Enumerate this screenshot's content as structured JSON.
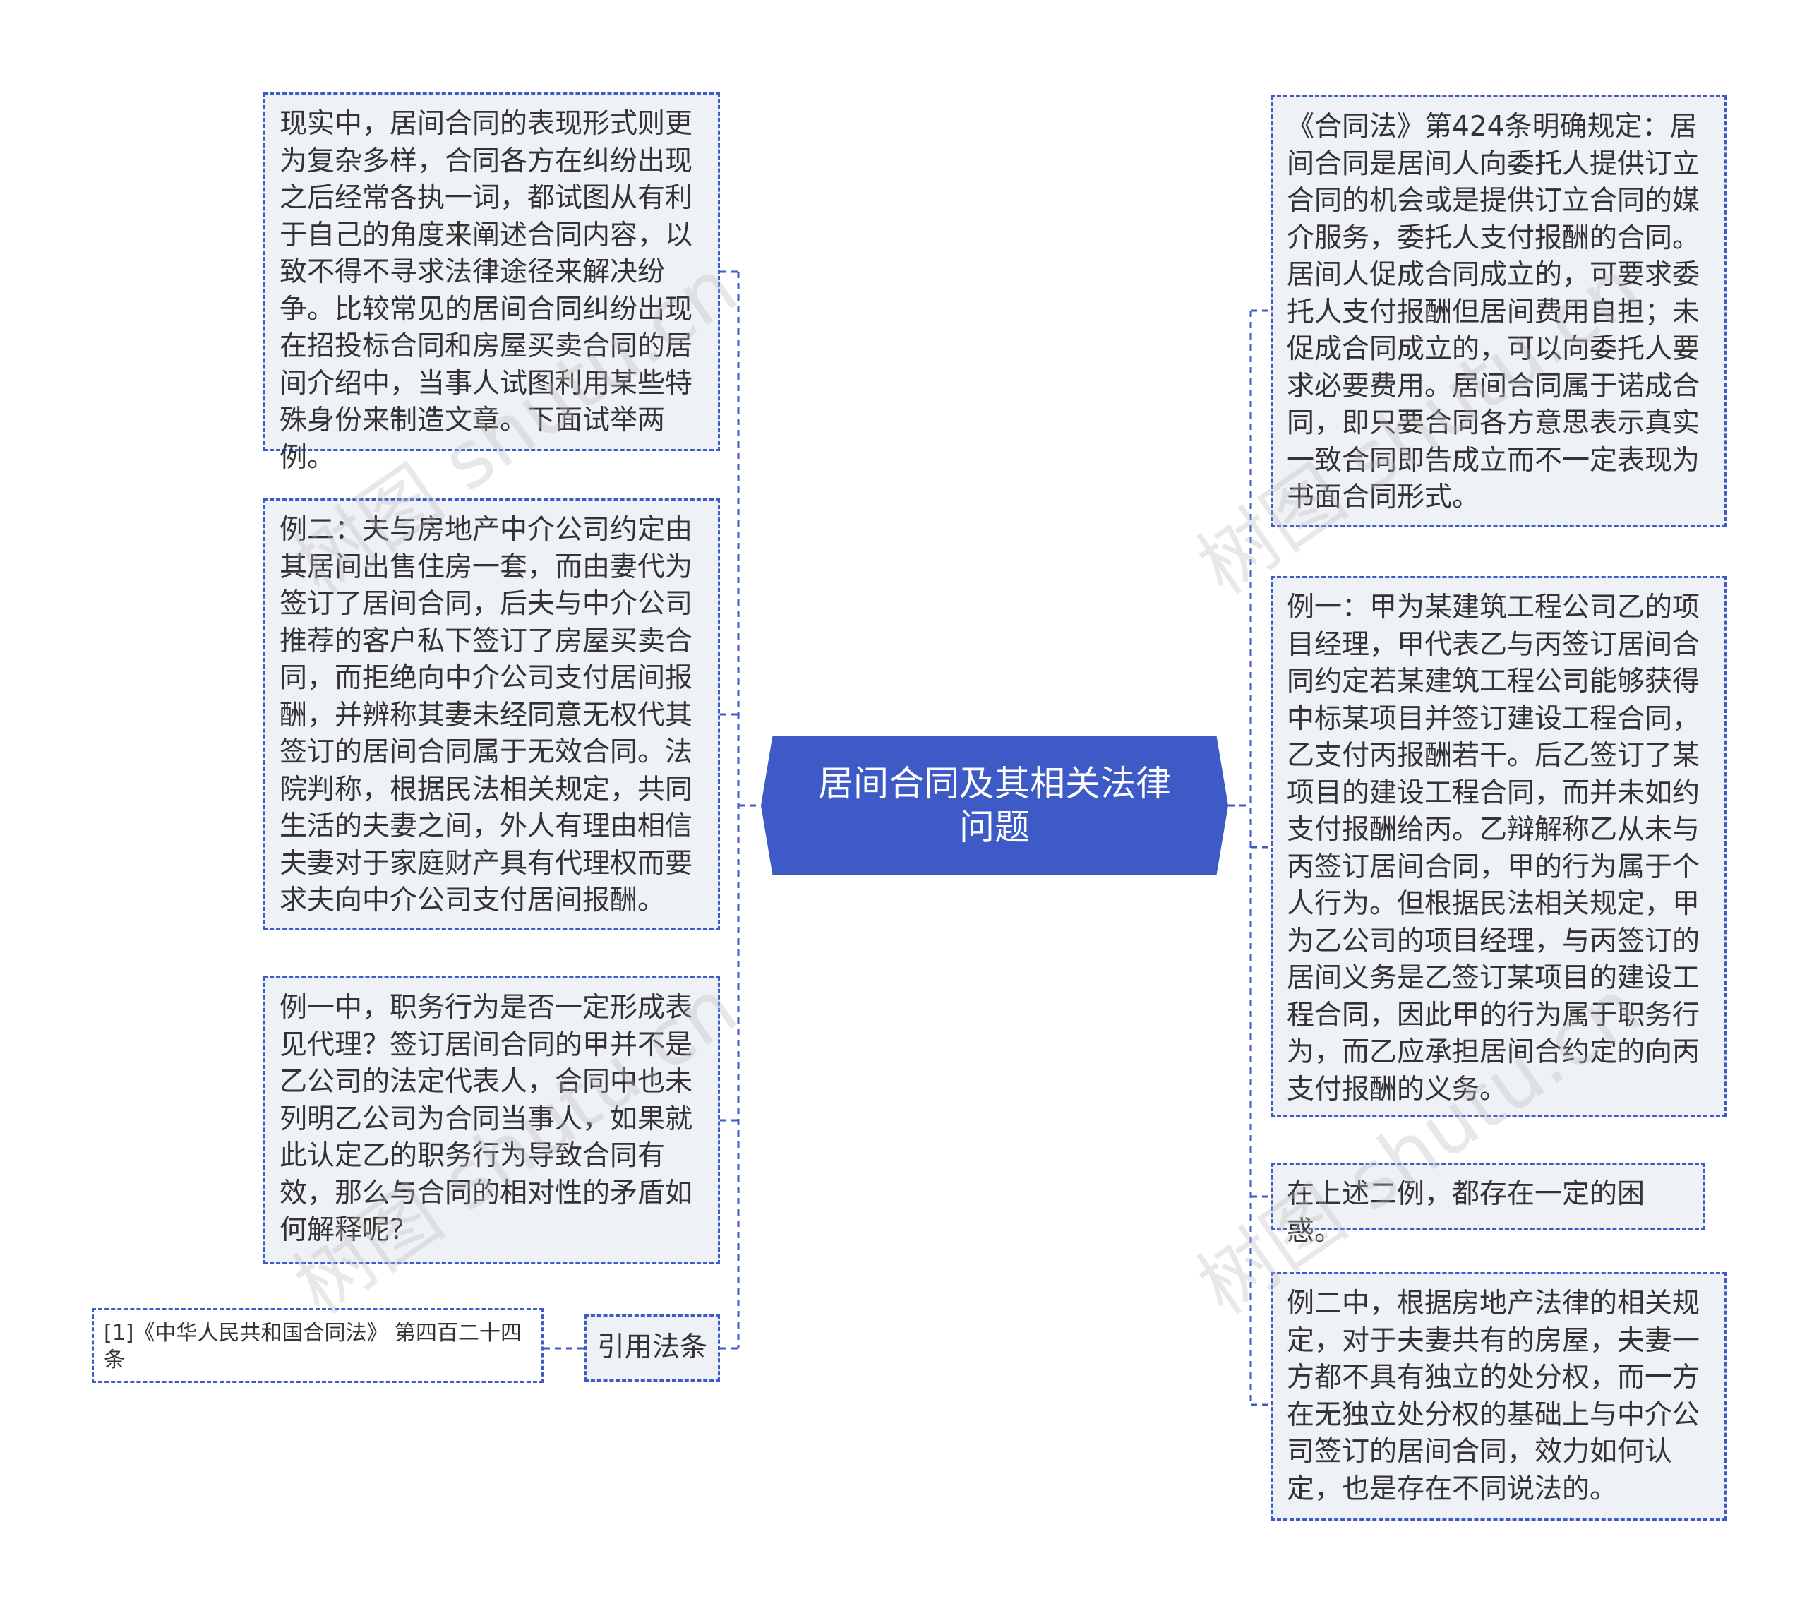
{
  "center": {
    "title": "居间合同及其相关法律问题"
  },
  "left_nodes": [
    {
      "text": "现实中，居间合同的表现形式则更为复杂多样，合同各方在纠纷出现之后经常各执一词，都试图从有利于自己的角度来阐述合同内容，以致不得不寻求法律途径来解决纷争。比较常见的居间合同纠纷出现在招投标合同和房屋买卖合同的居间介绍中，当事人试图利用某些特殊身份来制造文章。下面试举两例。"
    },
    {
      "text": "例二：夫与房地产中介公司约定由其居间出售住房一套，而由妻代为签订了居间合同，后夫与中介公司推荐的客户私下签订了房屋买卖合同，而拒绝向中介公司支付居间报酬，并辨称其妻未经同意无权代其签订的居间合同属于无效合同。法院判称，根据民法相关规定，共同生活的夫妻之间，外人有理由相信夫妻对于家庭财产具有代理权而要求夫向中介公司支付居间报酬。"
    },
    {
      "text": "例一中，职务行为是否一定形成表见代理？签订居间合同的甲并不是乙公司的法定代表人，合同中也未列明乙公司为合同当事人，如果就此认定乙的职务行为导致合同有效，那么与合同的相对性的矛盾如何解释呢？"
    }
  ],
  "citation": {
    "label": "引用法条",
    "reference": "[1]《中华人民共和国合同法》 第四百二十四条"
  },
  "right_nodes": [
    {
      "text": "《合同法》第424条明确规定：居间合同是居间人向委托人提供订立合同的机会或是提供订立合同的媒介服务，委托人支付报酬的合同。居间人促成合同成立的，可要求委托人支付报酬但居间费用自担；未促成合同成立的，可以向委托人要求必要费用。居间合同属于诺成合同，即只要合同各方意思表示真实一致合同即告成立而不一定表现为书面合同形式。"
    },
    {
      "text": "例一：甲为某建筑工程公司乙的项目经理，甲代表乙与丙签订居间合同约定若某建筑工程公司能够获得中标某项目并签订建设工程合同，乙支付丙报酬若干。后乙签订了某项目的建设工程合同，而并未如约支付报酬给丙。乙辩解称乙从未与丙签订居间合同，甲的行为属于个人行为。但根据民法相关规定，甲为乙公司的项目经理，与丙签订的居间义务是乙签订某项目的建设工程合同，因此甲的行为属于职务行为，而乙应承担居间合约定的向丙支付报酬的义务。"
    },
    {
      "text": "在上述二例，都存在一定的困惑。"
    },
    {
      "text": "例二中，根据房地产法律的相关规定，对于夫妻共有的房屋，夫妻一方都不具有独立的处分权，而一方在无独立处分权的基础上与中介公司签订的居间合同，效力如何认定，也是存在不同说法的。"
    }
  ],
  "watermarks": [
    "树图 shutu.cn",
    "树图 shutu.cn",
    "树图 shutu.cn",
    "树图 shutu.cn"
  ],
  "colors": {
    "accent": "#3d5ac7",
    "node_fill": "#eef1f5",
    "text": "#333333"
  }
}
